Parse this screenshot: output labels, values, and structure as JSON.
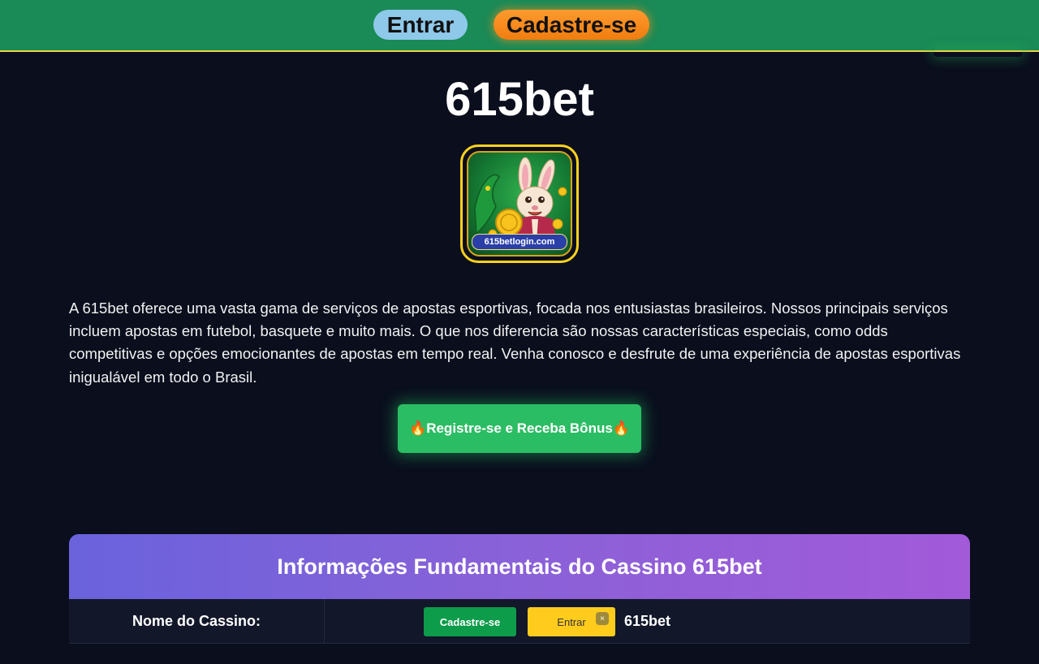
{
  "header": {
    "login_label": "Entrar",
    "signup_label": "Cadastre-se"
  },
  "page": {
    "title": "615bet"
  },
  "logo": {
    "site_text": "615betlogin.com"
  },
  "intro": {
    "text": "A 615bet oferece uma vasta gama de serviços de apostas esportivas, focada nos entusiastas brasileiros. Nossos principais serviços incluem apostas em futebol, basquete e muito mais. O que nos diferencia são nossas características especiais, como odds competitivas e opções emocionantes de apostas em tempo real. Venha conosco e desfrute de uma experiência de apostas esportivas inigualável em todo o Brasil."
  },
  "cta": {
    "label": "Registre-se e Receba Bônus",
    "icon": "fire-icon",
    "icon_glyph": "🔥"
  },
  "info": {
    "heading": "Informações Fundamentais do Cassino 615bet",
    "rows": [
      {
        "label": "Nome do Cassino:",
        "signup_label": "Cadastre-se",
        "login_label": "Entrar",
        "close_glyph": "×",
        "value": "615bet"
      }
    ]
  },
  "colors": {
    "background": "#0a0e1d",
    "topbar": "#1a8a56",
    "login_button": "#8fc9ea",
    "signup_button": "#f58a1f",
    "cta": "#2bbd63",
    "card_header_start": "#6a63dc",
    "card_header_end": "#a25ad9",
    "logo_border": "#ffd21c"
  }
}
